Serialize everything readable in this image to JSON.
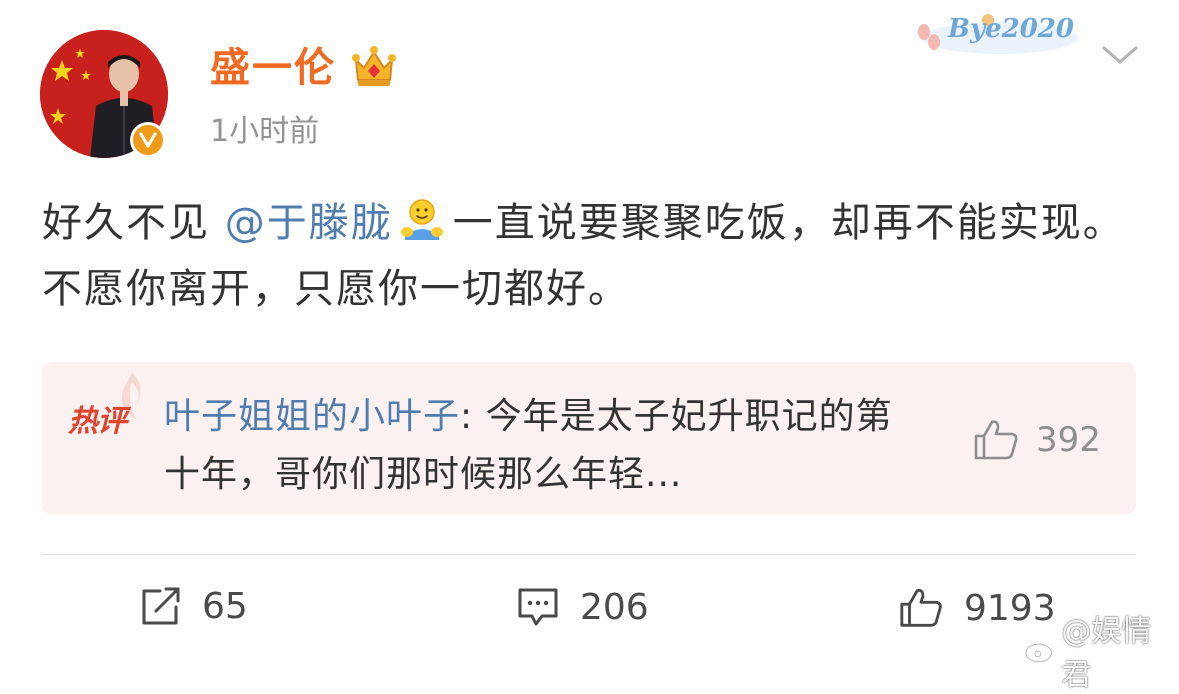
{
  "post": {
    "username": "盛一伦",
    "time": "1小时前",
    "badge_text": "Bye2020",
    "content_before_mention": "好久不见",
    "mention": "@于滕胧",
    "content_after_mention": "一直说要聚聚吃饭，却再不能实现。不愿你离开，只愿你一切都好。"
  },
  "hot_comment": {
    "label": "热评",
    "commenter": "叶子姐姐的小叶子",
    "separator": ": ",
    "text": "今年是太子妃升职记的第十年，哥你们那时候那么年轻...",
    "likes": "392"
  },
  "actions": {
    "reposts": "65",
    "comments": "206",
    "likes": "9193"
  },
  "watermark": "@娱情君",
  "colors": {
    "username": "#f26a21",
    "link": "#507daf",
    "hot_label": "#e0442f",
    "hot_bg": "#fbf1f0",
    "verified": "#f09a1a"
  },
  "icons": {
    "crown": "crown-icon",
    "verified": "verified-v-icon",
    "chevron": "chevron-down-icon",
    "emoji": "hug-emoji-icon",
    "repost": "repost-icon",
    "comment": "comment-icon",
    "like": "thumbs-up-icon"
  }
}
